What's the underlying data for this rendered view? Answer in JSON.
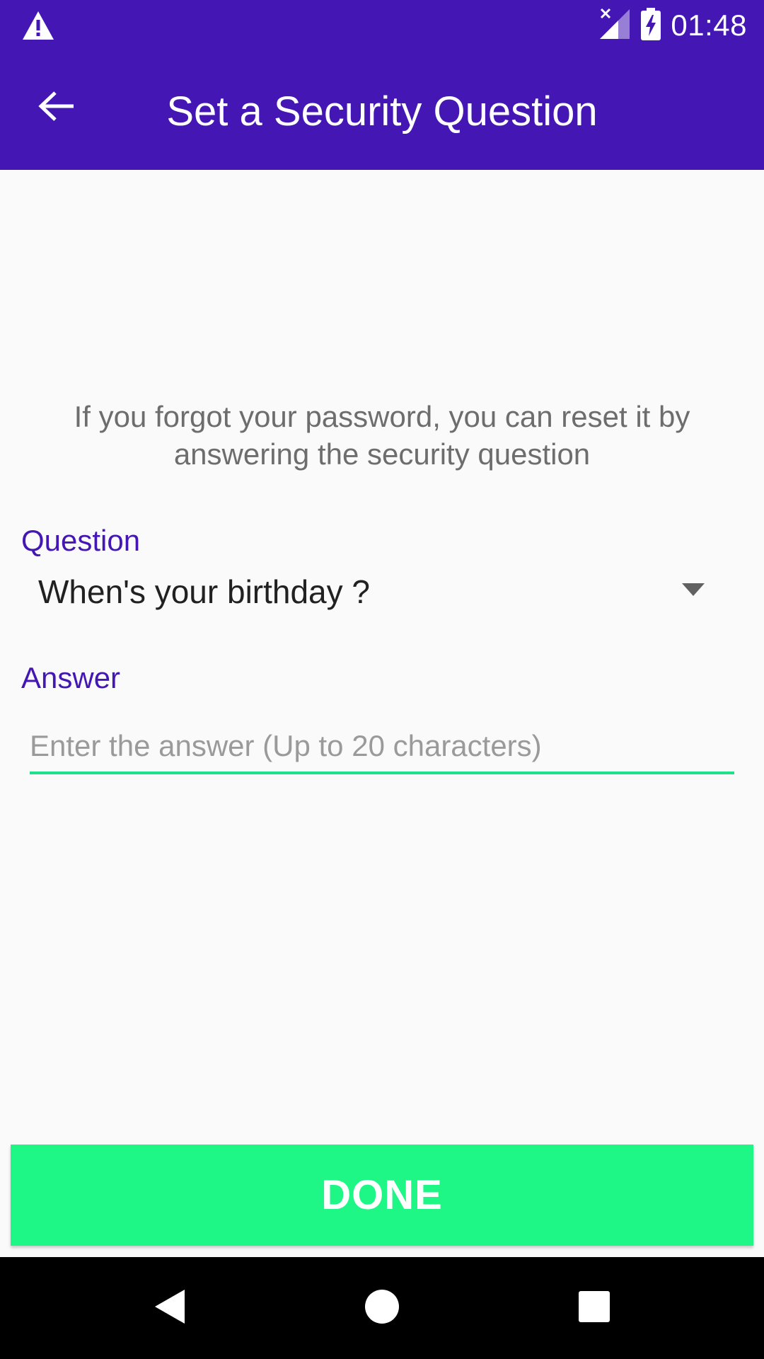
{
  "status_bar": {
    "time": "01:48",
    "icons": [
      "warning-icon",
      "signal-off-icon",
      "battery-charging-icon"
    ]
  },
  "app_bar": {
    "title": "Set a Security Question",
    "back_icon": "arrow-back-icon"
  },
  "content": {
    "info_text": "If you forgot your password, you can reset it by answering the security question",
    "question_label": "Question",
    "question_value": "When's your birthday ?",
    "answer_label": "Answer",
    "answer_placeholder": "Enter the answer (Up to 20 characters)"
  },
  "done_button": {
    "label": "DONE"
  },
  "nav_bar": {
    "icons": [
      "nav-back-icon",
      "nav-home-icon",
      "nav-recents-icon"
    ]
  },
  "colors": {
    "primary": "#4417b4",
    "accent": "#1ef786",
    "background": "#fafafa"
  }
}
